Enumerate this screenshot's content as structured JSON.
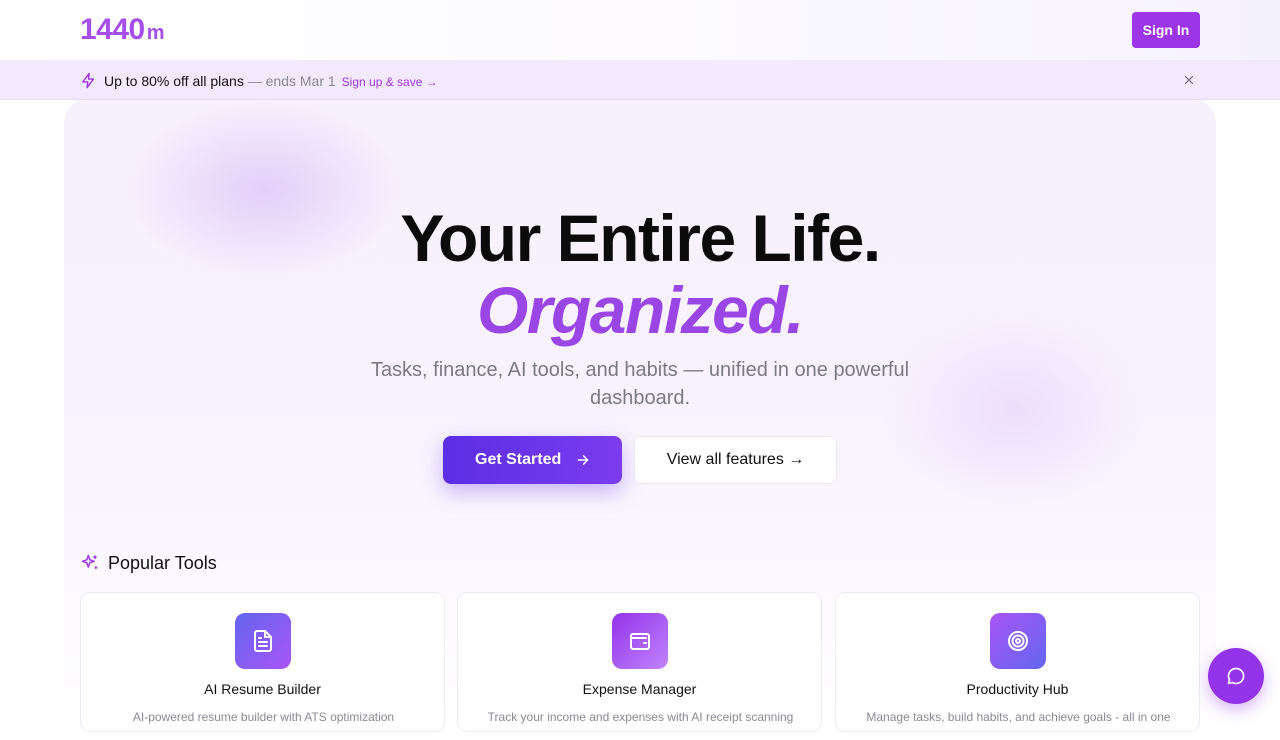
{
  "header": {
    "logo_main": "1440",
    "logo_suffix": "m",
    "signin_label": "Sign In"
  },
  "promo": {
    "bold_text": "Up to 80% off all plans",
    "muted_text": " — ends Mar 1",
    "link_text": "Sign up & save →",
    "icon": "lightning-icon"
  },
  "hero": {
    "title_line1": "Your Entire Life.",
    "title_line2": "Organized.",
    "subtitle": "Tasks, finance, AI tools, and habits — unified in one powerful dashboard.",
    "primary_cta": "Get Started",
    "secondary_cta": "View all features →"
  },
  "popular_tools": {
    "title": "Popular Tools",
    "icon": "sparkle-icon",
    "items": [
      {
        "title": "AI Resume Builder",
        "description": "AI-powered resume builder with ATS optimization",
        "icon": "document-icon"
      },
      {
        "title": "Expense Manager",
        "description": "Track your income and expenses with AI receipt scanning",
        "icon": "wallet-icon"
      },
      {
        "title": "Productivity Hub",
        "description": "Manage tasks, build habits, and achieve goals - all in one",
        "icon": "target-icon"
      }
    ]
  },
  "colors": {
    "brand": "#9b35e6",
    "cta_start": "#5b2ee6",
    "cta_end": "#7b3cee",
    "promo_bg": "#f3e9fd"
  }
}
